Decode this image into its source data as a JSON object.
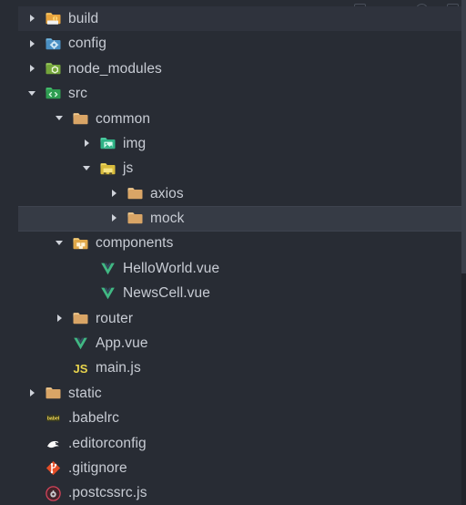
{
  "window": {
    "background_color": "#282c34",
    "selection_color": "#363b45",
    "hover_color": "#2f333d",
    "text_color": "#c8ccd4"
  },
  "toolbar": {
    "icons": [
      {
        "name": "collapse-all-icon",
        "label": ""
      },
      {
        "name": "minus-icon",
        "label": ""
      },
      {
        "name": "refresh-icon",
        "label": ""
      },
      {
        "name": "more-actions-icon",
        "label": ""
      }
    ]
  },
  "tree": {
    "items": [
      {
        "label": "build",
        "depth": 0,
        "type": "folder",
        "icon": "folder-build-icon",
        "state": "collapsed",
        "row_state": "hovered"
      },
      {
        "label": "config",
        "depth": 0,
        "type": "folder",
        "icon": "folder-config-icon",
        "state": "collapsed",
        "row_state": "normal"
      },
      {
        "label": "node_modules",
        "depth": 0,
        "type": "folder",
        "icon": "folder-node-icon",
        "state": "collapsed",
        "row_state": "normal"
      },
      {
        "label": "src",
        "depth": 0,
        "type": "folder",
        "icon": "folder-src-icon",
        "state": "expanded",
        "row_state": "normal"
      },
      {
        "label": "common",
        "depth": 1,
        "type": "folder",
        "icon": "folder-generic-tan-icon",
        "state": "expanded",
        "row_state": "normal"
      },
      {
        "label": "img",
        "depth": 2,
        "type": "folder",
        "icon": "folder-images-icon",
        "state": "collapsed",
        "row_state": "normal"
      },
      {
        "label": "js",
        "depth": 2,
        "type": "folder",
        "icon": "folder-js-icon",
        "state": "expanded",
        "row_state": "normal"
      },
      {
        "label": "axios",
        "depth": 3,
        "type": "folder",
        "icon": "folder-generic-tan-icon",
        "state": "collapsed",
        "row_state": "normal"
      },
      {
        "label": "mock",
        "depth": 3,
        "type": "folder",
        "icon": "folder-generic-tan-icon",
        "state": "collapsed",
        "row_state": "selected"
      },
      {
        "label": "components",
        "depth": 1,
        "type": "folder",
        "icon": "folder-components-icon",
        "state": "expanded",
        "row_state": "normal"
      },
      {
        "label": "HelloWorld.vue",
        "depth": 2,
        "type": "file",
        "icon": "vue-file-icon",
        "state": "none",
        "row_state": "normal"
      },
      {
        "label": "NewsCell.vue",
        "depth": 2,
        "type": "file",
        "icon": "vue-file-icon",
        "state": "none",
        "row_state": "normal"
      },
      {
        "label": "router",
        "depth": 1,
        "type": "folder",
        "icon": "folder-generic-tan-icon",
        "state": "collapsed",
        "row_state": "normal"
      },
      {
        "label": "App.vue",
        "depth": 1,
        "type": "file",
        "icon": "vue-file-icon",
        "state": "none",
        "row_state": "normal"
      },
      {
        "label": "main.js",
        "depth": 1,
        "type": "file",
        "icon": "js-file-icon",
        "state": "none",
        "row_state": "normal"
      },
      {
        "label": "static",
        "depth": 0,
        "type": "folder",
        "icon": "folder-generic-tan-icon",
        "state": "collapsed",
        "row_state": "normal"
      },
      {
        "label": ".babelrc",
        "depth": 0,
        "type": "file",
        "icon": "babel-file-icon",
        "state": "none",
        "row_state": "normal"
      },
      {
        "label": ".editorconfig",
        "depth": 0,
        "type": "file",
        "icon": "editorconfig-file-icon",
        "state": "none",
        "row_state": "normal"
      },
      {
        "label": ".gitignore",
        "depth": 0,
        "type": "file",
        "icon": "git-file-icon",
        "state": "none",
        "row_state": "normal"
      },
      {
        "label": ".postcssrc.js",
        "depth": 0,
        "type": "file",
        "icon": "postcss-file-icon",
        "state": "none",
        "row_state": "normal"
      }
    ]
  }
}
